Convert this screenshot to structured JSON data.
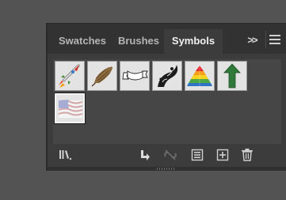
{
  "tabs": [
    {
      "label": "Swatches",
      "active": false
    },
    {
      "label": "Brushes",
      "active": false
    },
    {
      "label": "Symbols",
      "active": true
    }
  ],
  "collapse_label": ">>",
  "symbols": [
    {
      "name": "Rocket",
      "icon": "rocket-icon"
    },
    {
      "name": "Feather",
      "icon": "feather-icon"
    },
    {
      "name": "Banner",
      "icon": "banner-icon"
    },
    {
      "name": "Floral Ornament",
      "icon": "floral-icon"
    },
    {
      "name": "Pyramid",
      "icon": "pyramid-icon"
    },
    {
      "name": "Up Arrow",
      "icon": "arrow-up-icon"
    },
    {
      "name": "Flag",
      "icon": "flag-icon",
      "selected": true
    }
  ],
  "toolbar": [
    "symbol-libraries-icon",
    "place-symbol-instance-icon",
    "break-link-icon",
    "symbol-options-icon",
    "new-symbol-icon",
    "delete-symbol-icon"
  ],
  "colors": {
    "panel_bg": "#3c3c3c",
    "tabbar_bg": "#323232",
    "active_tab_text": "#f0f0f0",
    "inactive_tab_text": "#b5b5b5",
    "swatch_bg": "#e3e3e3"
  }
}
